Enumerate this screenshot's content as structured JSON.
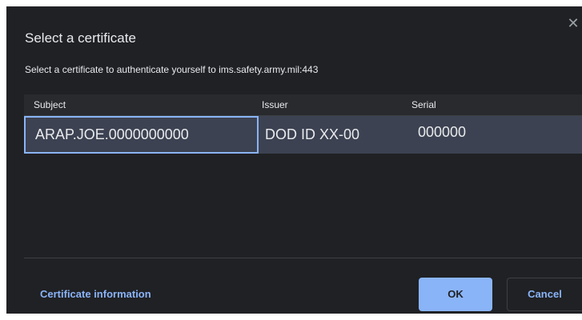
{
  "dialog": {
    "title": "Select a certificate",
    "subtitle": "Select a certificate to authenticate yourself to ims.safety.army.mil:443",
    "close_icon": "close-icon",
    "close_glyph": "✕"
  },
  "table": {
    "headers": {
      "subject": "Subject",
      "issuer": "Issuer",
      "serial": "Serial"
    },
    "rows": [
      {
        "subject": "ARAP.JOE.0000000000",
        "issuer": "DOD ID XX-00",
        "serial": "000000",
        "selected": true
      }
    ]
  },
  "footer": {
    "certificate_info_label": "Certificate information",
    "ok_label": "OK",
    "cancel_label": "Cancel"
  },
  "colors": {
    "background": "#202124",
    "accent": "#8ab4f8",
    "selected_row": "#3c4251",
    "text": "#e8eaed"
  }
}
